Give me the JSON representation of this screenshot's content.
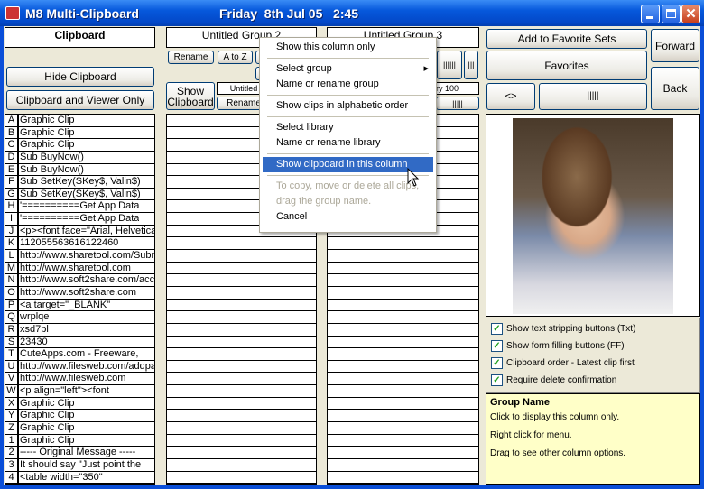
{
  "window": {
    "title": "M8 Multi-Clipboard",
    "date": "Friday  8th Jul 05   2:45"
  },
  "clipboard": {
    "header": "Clipboard",
    "hide_button": "Hide Clipboard",
    "viewer_only_button": "Clipboard and Viewer Only",
    "clips": [
      [
        "A",
        "Graphic Clip"
      ],
      [
        "B",
        "Graphic Clip"
      ],
      [
        "C",
        "Graphic Clip"
      ],
      [
        "D",
        "Sub BuyNow()"
      ],
      [
        "E",
        "Sub BuyNow()"
      ],
      [
        "F",
        "Sub SetKey(SKey$, Valin$)"
      ],
      [
        "G",
        "Sub SetKey(SKey$, Valin$)"
      ],
      [
        "H",
        "'==========Get App Data"
      ],
      [
        "I",
        "'==========Get App Data"
      ],
      [
        "J",
        "<p><font face=\"Arial, Helvetica,"
      ],
      [
        "K",
        "112055563616122460"
      ],
      [
        "L",
        "http://www.sharetool.com/Subm"
      ],
      [
        "M",
        "http://www.sharetool.com"
      ],
      [
        "N",
        "http://www.soft2share.com/acc"
      ],
      [
        "O",
        "http://www.soft2share.com"
      ],
      [
        "P",
        "<a target=\"_BLANK\""
      ],
      [
        "Q",
        "wrplqe"
      ],
      [
        "R",
        "xsd7pl"
      ],
      [
        "S",
        "23430"
      ],
      [
        "T",
        "CuteApps.com - Freeware,"
      ],
      [
        "U",
        "http://www.filesweb.com/addpa"
      ],
      [
        "V",
        "http://www.filesweb.com"
      ],
      [
        "W",
        "<p align=\"left\"><font"
      ],
      [
        "X",
        "Graphic Clip"
      ],
      [
        "Y",
        "Graphic Clip"
      ],
      [
        "Z",
        "Graphic Clip"
      ],
      [
        "1",
        "Graphic Clip"
      ],
      [
        "2",
        "----- Original Message -----"
      ],
      [
        "3",
        "It should say \"Just point the"
      ],
      [
        "4",
        "<table width=\"350\""
      ]
    ]
  },
  "group2": {
    "header": "Untitled Group 2",
    "rename": "Rename",
    "atoz": "A to Z",
    "show_clipboard": "Show Clipboard",
    "sub_name": "Untitled",
    "sub_rename": "Rename"
  },
  "group3": {
    "header": "Untitled Group 3",
    "bars1": "||||||",
    "bars2": "|||",
    "library": "Library 100",
    "bars3": "|||||"
  },
  "right": {
    "add_fav": "Add to Favorite Sets",
    "favorites": "Favorites",
    "forward": "Forward",
    "back": "Back",
    "code": "<>",
    "bars": "|||||"
  },
  "options": [
    {
      "label": "Show text stripping buttons (Txt)",
      "checked": true
    },
    {
      "label": "Show form filling buttons (FF)",
      "checked": true
    },
    {
      "label": "Clipboard order - Latest clip first",
      "checked": true
    },
    {
      "label": "Require delete confirmation",
      "checked": true
    }
  ],
  "help": {
    "title": "Group Name",
    "lines": [
      "Click to display this column only.",
      "Right click for menu.",
      "Drag to see other column options."
    ]
  },
  "menu": {
    "show_column_only": "Show this column only",
    "select_group": "Select group",
    "rename_group": "Name or rename group",
    "alphabetic": "Show clips in alphabetic order",
    "select_library": "Select library",
    "rename_library": "Name or rename library",
    "show_clipboard": "Show clipboard in this column",
    "hint1": "To copy, move or delete all clips,",
    "hint2": "drag the group name.",
    "cancel": "Cancel"
  }
}
